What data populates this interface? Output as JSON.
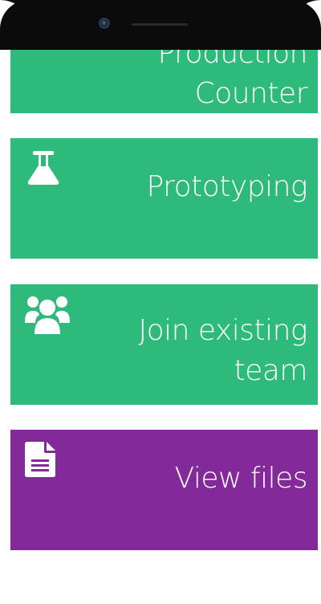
{
  "tiles": [
    {
      "label_line1": "Production",
      "label_line2": "Counter",
      "color": "#2dba7a",
      "icon": "none"
    },
    {
      "label": "Prototyping",
      "color": "#2dba7a",
      "icon": "flask-icon"
    },
    {
      "label_line1": "Join existing",
      "label_line2": "team",
      "color": "#2dba7a",
      "icon": "users-group-icon"
    },
    {
      "label": "View files",
      "color": "#84299a",
      "icon": "document-icon"
    }
  ]
}
